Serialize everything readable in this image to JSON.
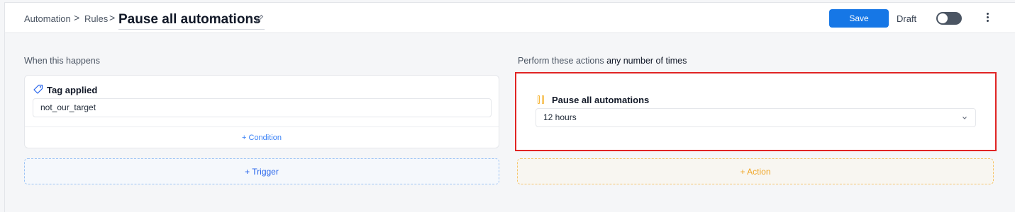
{
  "breadcrumb": {
    "items": [
      "Automation",
      "Rules"
    ],
    "separator": ">"
  },
  "header": {
    "title": "Pause all automations",
    "save_label": "Save",
    "status_label": "Draft",
    "toggle_on": false,
    "accent_color": "#1677e6"
  },
  "trigger_section": {
    "label": "When this happens",
    "trigger": {
      "icon": "tag-icon",
      "title": "Tag applied",
      "value": "not_our_target"
    },
    "condition_label": "+ Condition",
    "add_trigger_label": "+ Trigger"
  },
  "action_section": {
    "label_prefix": "Perform these actions",
    "label_emphasis": "any number of times",
    "action": {
      "icon": "pause-icon",
      "title": "Pause all automations",
      "selected": "12 hours"
    },
    "add_action_label": "+ Action",
    "highlight_color": "#e02424"
  }
}
